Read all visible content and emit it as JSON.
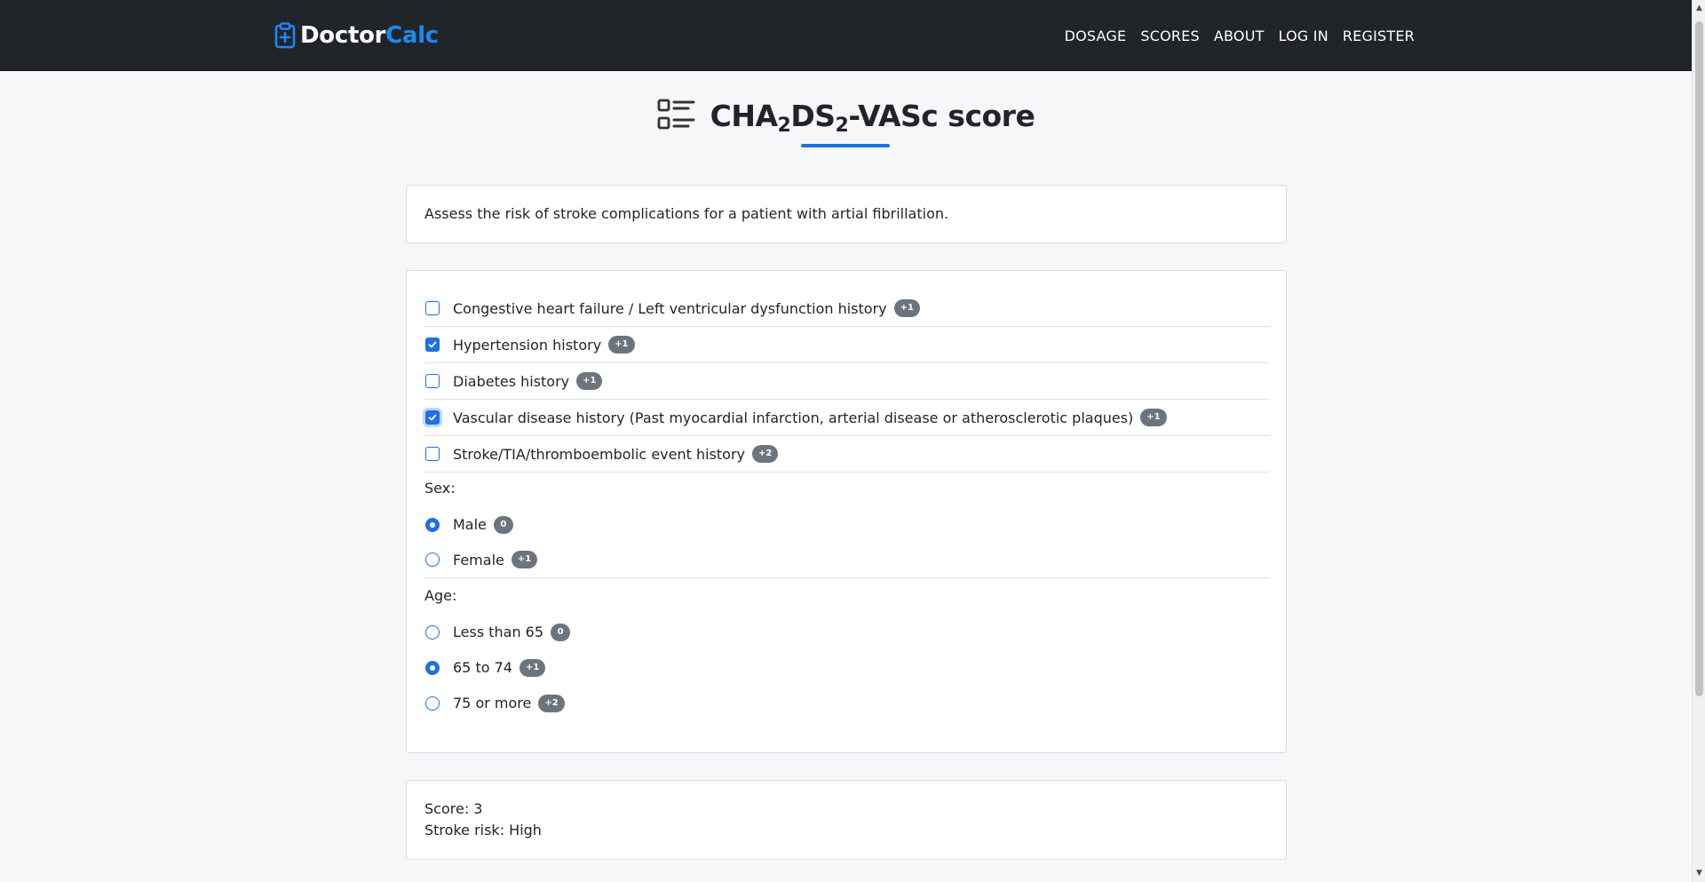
{
  "nav": {
    "brand_primary": "Doctor",
    "brand_accent": "Calc",
    "links": [
      "DOSAGE",
      "SCORES",
      "ABOUT",
      "LOG IN",
      "REGISTER"
    ]
  },
  "page": {
    "title_part1": "CHA",
    "title_sub1": "2",
    "title_part2": "DS",
    "title_sub2": "2",
    "title_part3": "-VASc score",
    "description": "Assess the risk of stroke complications for a patient with artial fibrillation."
  },
  "criteria": [
    {
      "label": "Congestive heart failure / Left ventricular dysfunction history",
      "points": "+1",
      "checked": false
    },
    {
      "label": "Hypertension history",
      "points": "+1",
      "checked": true
    },
    {
      "label": "Diabetes history",
      "points": "+1",
      "checked": false
    },
    {
      "label": "Vascular disease history (Past myocardial infarction, arterial disease or atherosclerotic plaques)",
      "points": "+1",
      "checked": true
    },
    {
      "label": "Stroke/TIA/thromboembolic event history",
      "points": "+2",
      "checked": false
    }
  ],
  "sex": {
    "label": "Sex:",
    "options": [
      {
        "label": "Male",
        "points": "0",
        "selected": true
      },
      {
        "label": "Female",
        "points": "+1",
        "selected": false
      }
    ]
  },
  "age": {
    "label": "Age:",
    "options": [
      {
        "label": "Less than 65",
        "points": "0",
        "selected": false
      },
      {
        "label": "65 to 74",
        "points": "+1",
        "selected": true
      },
      {
        "label": "75 or more",
        "points": "+2",
        "selected": false
      }
    ]
  },
  "result": {
    "score": "Score: 3",
    "risk": "Stroke risk: High"
  },
  "colors": {
    "navbar": "#212529",
    "accent": "#1f87f5",
    "control": "#1f6fe5",
    "badge": "#6c757d"
  }
}
